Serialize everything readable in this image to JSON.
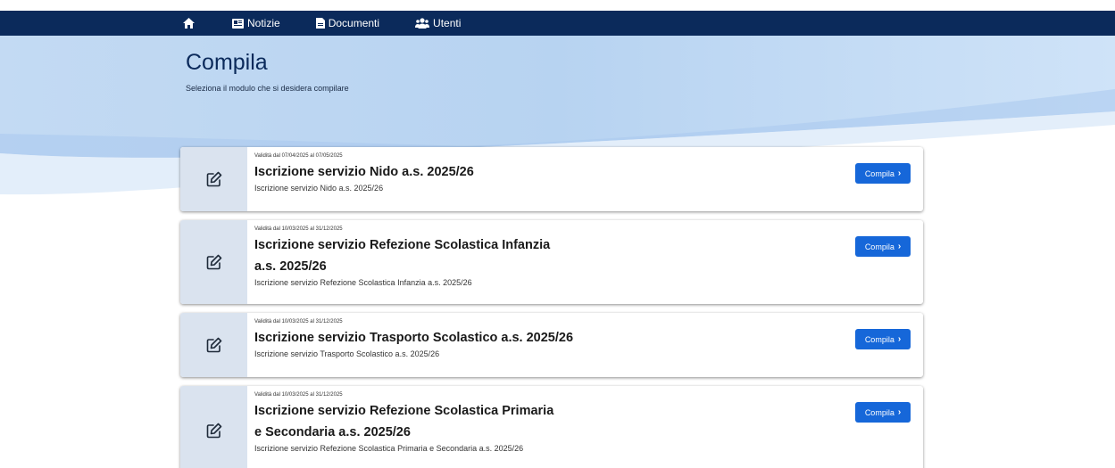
{
  "nav": {
    "home_icon": "home-icon",
    "items": [
      {
        "label": "Notizie",
        "icon": "newspaper-icon"
      },
      {
        "label": "Documenti",
        "icon": "document-icon"
      },
      {
        "label": "Utenti",
        "icon": "users-icon"
      }
    ]
  },
  "page": {
    "title": "Compila",
    "subtitle": "Seleziona il modulo che si desidera compilare"
  },
  "cards": [
    {
      "validity": "Validità dal 07/04/2025 al 07/05/2025",
      "title": "Iscrizione servizio Nido a.s. 2025/26",
      "description": "Iscrizione servizio Nido a.s. 2025/26",
      "button": "Compila"
    },
    {
      "validity": "Validità dal 10/03/2025 al 31/12/2025",
      "title": "Iscrizione servizio Refezione Scolastica Infanzia a.s. 2025/26",
      "description": "Iscrizione servizio Refezione Scolastica Infanzia a.s. 2025/26",
      "button": "Compila"
    },
    {
      "validity": "Validità dal 10/03/2025 al 31/12/2025",
      "title": "Iscrizione servizio Trasporto Scolastico a.s. 2025/26",
      "description": "Iscrizione servizio Trasporto Scolastico a.s. 2025/26",
      "button": "Compila"
    },
    {
      "validity": "Validità dal 10/03/2025 al 31/12/2025",
      "title": "Iscrizione servizio Refezione Scolastica Primaria e Secondaria a.s. 2025/26",
      "description": "Iscrizione servizio Refezione Scolastica Primaria e Secondaria a.s. 2025/26",
      "button": "Compila"
    }
  ],
  "colors": {
    "navbar": "#0b2a5b",
    "button": "#1667d9",
    "icon_column": "#dae3ef",
    "title": "#0b2a5b"
  }
}
